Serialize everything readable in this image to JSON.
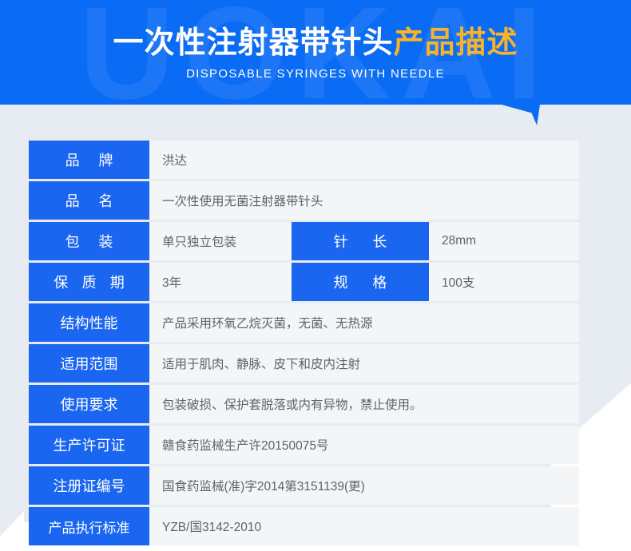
{
  "banner": {
    "watermark": "UOKAI",
    "title_main": "一次性注射器带针头",
    "title_accent": "产品描述",
    "subtitle": "DISPOSABLE SYRINGES WITH NEEDLE",
    "bg_color": "#0a6bf5",
    "accent_color": "#f7b32b"
  },
  "theme": {
    "label_blue": "#1a66f0",
    "value_bg": "#f4f5f7",
    "page_bg": "#e7ecf3",
    "value_text": "#5f6368"
  },
  "spec_table": {
    "rows": [
      {
        "label": "品牌",
        "label_chars": [
          "品",
          "牌"
        ],
        "value": "洪达",
        "split": false
      },
      {
        "label": "品名",
        "label_chars": [
          "品",
          "名"
        ],
        "value": "一次性使用无菌注射器带针头",
        "split": false
      },
      {
        "label": "包装",
        "label_chars": [
          "包",
          "装"
        ],
        "value": "单只独立包装",
        "split": true,
        "label2": "针长",
        "label2_chars": [
          "针",
          "长"
        ],
        "value2": "28mm"
      },
      {
        "label": "保质期",
        "label_chars": [
          "保",
          "质",
          "期"
        ],
        "value": "3年",
        "split": true,
        "label2": "规格",
        "label2_chars": [
          "规",
          "格"
        ],
        "value2": "100支"
      },
      {
        "label": "结构性能",
        "label_chars": [
          "结",
          "构",
          "性",
          "能"
        ],
        "value": "产品采用环氧乙烷灭菌，无菌、无热源",
        "split": false
      },
      {
        "label": "适用范围",
        "label_chars": [
          "适",
          "用",
          "范",
          "围"
        ],
        "value": "适用于肌肉、静脉、皮下和皮内注射",
        "split": false
      },
      {
        "label": "使用要求",
        "label_chars": [
          "使",
          "用",
          "要",
          "求"
        ],
        "value": "包装破损、保护套脱落或内有异物，禁止使用。",
        "split": false
      },
      {
        "label": "生产许可证",
        "label_chars": [
          "生",
          "产",
          "许",
          "可",
          "证"
        ],
        "value": "赣食药监械生产许20150075号",
        "split": false
      },
      {
        "label": "注册证编号",
        "label_chars": [
          "注",
          "册",
          "证",
          "编",
          "号"
        ],
        "value": "国食药监械(准)字2014第3151139(更)",
        "split": false
      },
      {
        "label": "产品执行标准",
        "label_chars": [
          "产",
          "品",
          "执",
          "行",
          "标",
          "准"
        ],
        "value": "YZB/国3142-2010",
        "split": false
      }
    ]
  }
}
